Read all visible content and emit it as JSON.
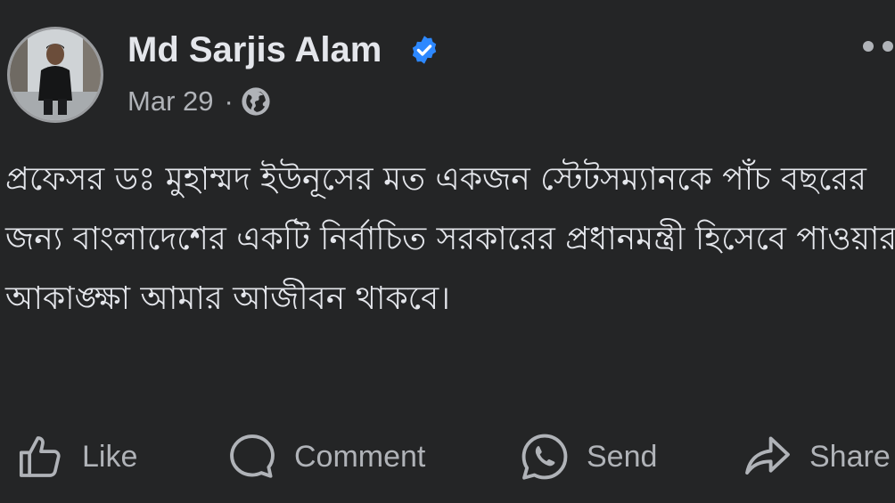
{
  "post": {
    "author": "Md Sarjis Alam",
    "date": "Mar 29",
    "separator": "·",
    "privacy_icon": "globe-icon",
    "verified_icon": "verified-badge-icon",
    "more_icon": "more-options-icon",
    "text": "প্রফেসর ডঃ মুহাম্মদ ইউনূসের মত একজন স্টেটসম্যানকে পাঁচ বছরের জন্য বাংলাদেশের একটি নির্বাচিত সরকারের প্রধানমন্ত্রী হিসেবে পাওয়ার আকাঙ্ক্ষা আমার আজীবন থাকবে।"
  },
  "actions": [
    {
      "label": "Like",
      "icon": "thumbs-up-icon"
    },
    {
      "label": "Comment",
      "icon": "comment-bubble-icon"
    },
    {
      "label": "Send",
      "icon": "whatsapp-icon"
    },
    {
      "label": "Share",
      "icon": "share-arrow-icon"
    }
  ],
  "colors": {
    "background": "#242526",
    "primary_text": "#e4e6eb",
    "secondary_text": "#b0b3b8",
    "verified_blue": "#2d88ff"
  }
}
